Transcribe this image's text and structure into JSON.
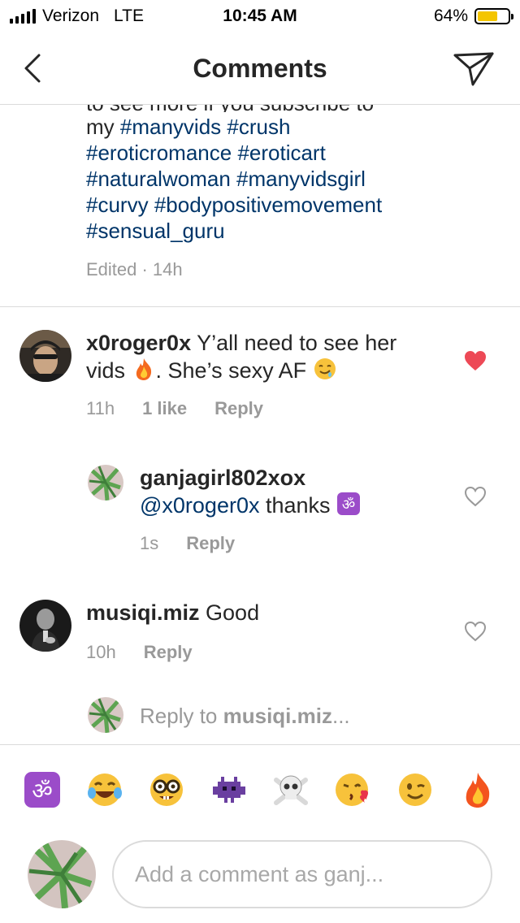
{
  "status_bar": {
    "carrier": "Verizon",
    "network": "LTE",
    "time": "10:45 AM",
    "battery": "64%",
    "battery_level": 0.64
  },
  "header": {
    "title": "Comments"
  },
  "caption": {
    "cut_line": "to see more if you subscribe to",
    "prefix": "my ",
    "tags_line1": [
      "#manyvids",
      "#crush"
    ],
    "tags_line2": [
      "#eroticromance",
      "#eroticart"
    ],
    "tags_line3": [
      "#naturalwoman",
      "#manyvidsgirl"
    ],
    "tags_line4": [
      "#curvy",
      "#bodypositivemovement"
    ],
    "tags_line5": [
      "#sensual_guru"
    ],
    "meta": "Edited · 14h"
  },
  "comments": [
    {
      "username": "x0roger0x",
      "text_part1": " Y’all need to see her",
      "text_part2": "vids ",
      "text_part3": ". She’s sexy AF ",
      "time": "11h",
      "likes": "1 like",
      "reply": "Reply",
      "liked": true
    },
    {
      "username": "ganjagirl802xox",
      "mention": "@x0roger0x",
      "text": " thanks ",
      "time": "1s",
      "reply": "Reply",
      "liked": false
    },
    {
      "username": "musiqi.miz",
      "text": " Good",
      "time": "10h",
      "reply": "Reply",
      "liked": false
    }
  ],
  "reply_prompt": {
    "prefix": "Reply to ",
    "username": "musiqi.miz",
    "suffix": "..."
  },
  "emoji_bar": [
    "om-icon",
    "tears-of-joy-icon",
    "nerd-face-icon",
    "alien-monster-icon",
    "skull-crossbones-icon",
    "kissing-heart-icon",
    "winking-face-icon",
    "fire-icon"
  ],
  "comment_input": {
    "placeholder": "Add a comment as ganj..."
  },
  "colors": {
    "link": "#003569",
    "like_red": "#ed4956",
    "meta_gray": "#999999",
    "divider": "#dbdbdb"
  }
}
